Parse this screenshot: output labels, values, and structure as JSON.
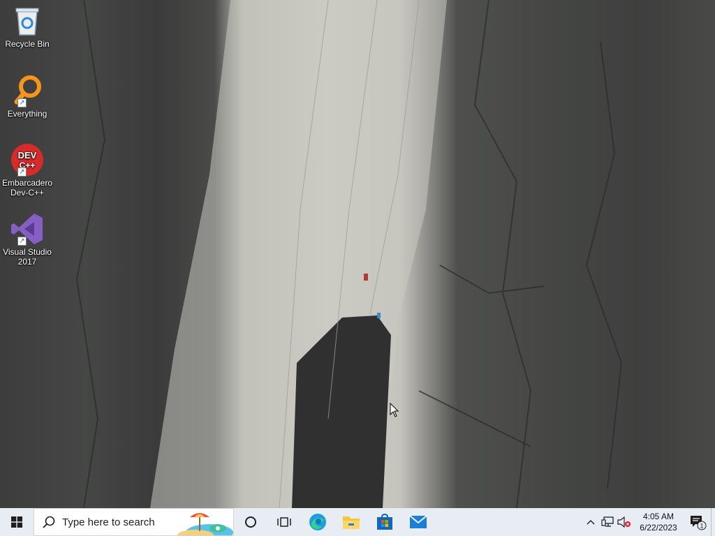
{
  "desktop": {
    "icons": [
      {
        "label": "Recycle Bin",
        "icon": "recycle-bin-icon"
      },
      {
        "label": "Everything",
        "icon": "everything-search-icon"
      },
      {
        "label": "Embarcadero Dev-C++",
        "icon": "dev-cpp-icon",
        "badge_text": "DEV C++"
      },
      {
        "label": "Visual Studio 2017",
        "icon": "visual-studio-icon"
      }
    ]
  },
  "taskbar": {
    "search_placeholder": "Type here to search",
    "pinned": [
      {
        "name": "Cortana",
        "icon": "cortana-circle-icon"
      },
      {
        "name": "Task View",
        "icon": "task-view-icon"
      },
      {
        "name": "Microsoft Edge",
        "icon": "edge-icon"
      },
      {
        "name": "File Explorer",
        "icon": "file-explorer-icon"
      },
      {
        "name": "Microsoft Store",
        "icon": "store-icon"
      },
      {
        "name": "Mail",
        "icon": "mail-icon"
      }
    ],
    "tray": {
      "time": "4:05 AM",
      "date": "6/22/2023",
      "notification_count": "1"
    }
  },
  "colors": {
    "taskbar_bg": "#e8edf3",
    "accent": "#0a64c8"
  }
}
